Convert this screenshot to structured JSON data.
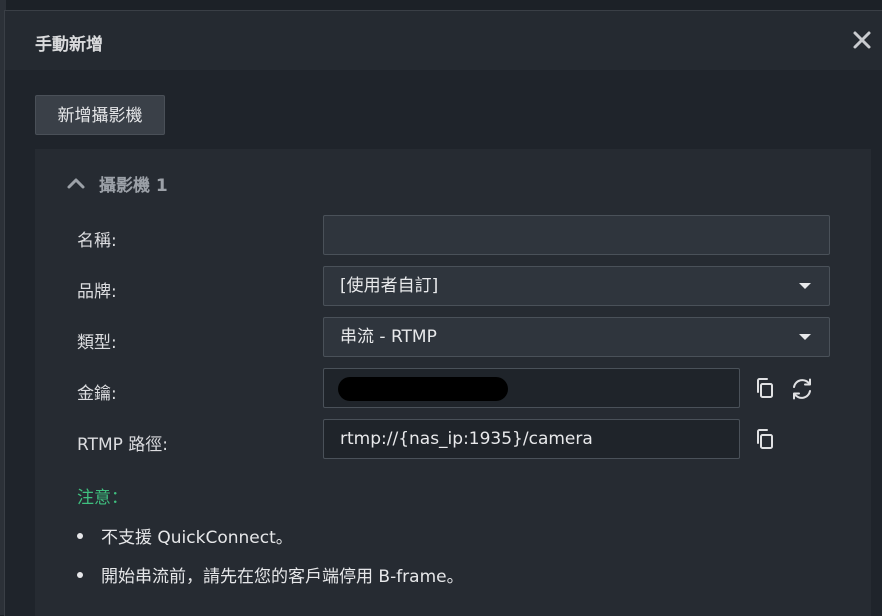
{
  "dialog": {
    "title": "手動新增",
    "add_camera_label": "新增攝影機"
  },
  "camera": {
    "header": "攝影機 1",
    "fields": {
      "name": {
        "label": "名稱:",
        "value": ""
      },
      "brand": {
        "label": "品牌:",
        "value": "[使用者自訂]"
      },
      "type": {
        "label": "類型:",
        "value": "串流 - RTMP"
      },
      "key": {
        "label": "金鑰:",
        "value": ""
      },
      "rtmp_path": {
        "label": "RTMP 路徑:",
        "value": "rtmp://{nas_ip:1935}/camera"
      }
    }
  },
  "notes": {
    "label": "注意：",
    "items": [
      "不支援 QuickConnect。",
      "開始串流前，請先在您的客戶端停用 B-frame。"
    ]
  },
  "icons": {
    "close": "close-icon",
    "collapse": "chevron-up-icon",
    "dropdown": "caret-down-icon",
    "copy": "copy-icon",
    "refresh": "refresh-icon"
  },
  "colors": {
    "note_accent": "#3fbf7f",
    "background": "#1f242b",
    "field": "#2f353d"
  }
}
